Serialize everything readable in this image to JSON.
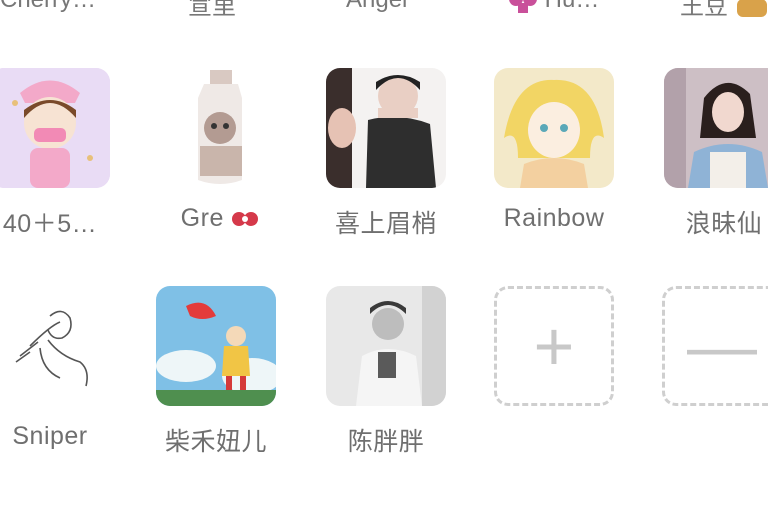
{
  "top_row_names": [
    "Cherry…",
    "宣里",
    "Angel",
    "Hu…",
    "王豆"
  ],
  "row1": [
    {
      "name": "40＋5…",
      "avatar_icon": "nurse-cartoon-icon"
    },
    {
      "name": "Gre",
      "avatar_icon": "cat-bottle-icon"
    },
    {
      "name": "喜上眉梢",
      "avatar_icon": "couple-photo-icon"
    },
    {
      "name": "Rainbow",
      "avatar_icon": "yellow-hair-girl-icon"
    },
    {
      "name": "浪昧仙",
      "avatar_icon": "girl-photo-icon"
    }
  ],
  "row2": [
    {
      "name": "Sniper",
      "avatar_icon": "line-sketch-icon"
    },
    {
      "name": "柴禾妞儿",
      "avatar_icon": "ponyo-icon"
    },
    {
      "name": "陈胖胖",
      "avatar_icon": "bw-photo-icon"
    }
  ],
  "add_button": {
    "symbol": "+"
  },
  "remove_button": {
    "symbol": "—"
  },
  "colors": {
    "dashed_border": "#cfcfcf",
    "label_text": "#6f6f6f",
    "background": "#ffffff"
  }
}
